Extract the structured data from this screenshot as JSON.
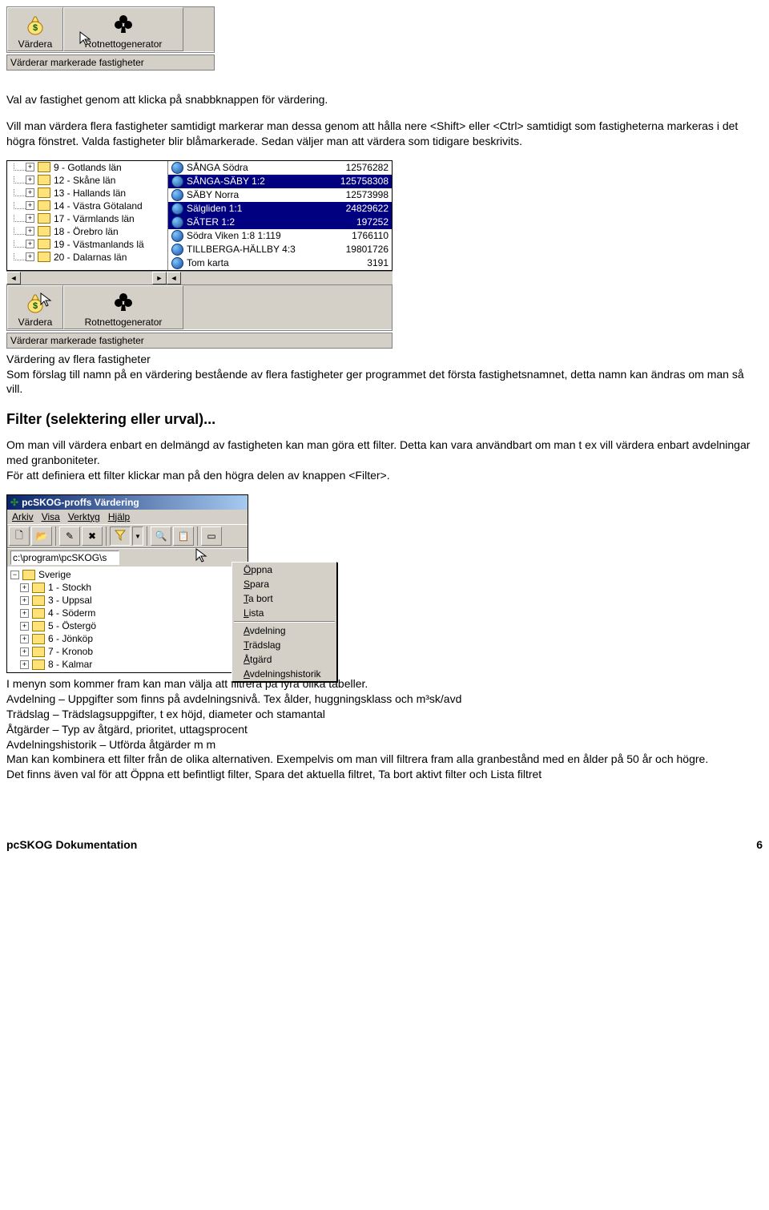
{
  "screenshot1": {
    "buttons": {
      "vardera": "Värdera",
      "rotnetto": "Rotnettogenerator"
    },
    "status": "Värderar markerade fastigheter"
  },
  "para1": "Val av fastighet genom att klicka på snabbknappen för värdering.",
  "para2": "Vill man värdera flera fastigheter samtidigt markerar man dessa genom att hålla nere <Shift> eller <Ctrl> samtidigt som fastigheterna markeras i det högra fönstret. Valda fastigheter blir blåmarkerade. Sedan väljer man att värdera som tidigare beskrivits.",
  "screenshot2": {
    "tree": [
      "9 - Gotlands län",
      "12 - Skåne län",
      "13 - Hallands län",
      "14 - Västra Götaland",
      "17 - Värmlands län",
      "18 - Örebro län",
      "19 - Västmanlands lä",
      "20 - Dalarnas län"
    ],
    "list": [
      {
        "name": "SÅNGA Södra",
        "value": "12576282",
        "selected": false
      },
      {
        "name": "SÅNGA-SÄBY 1:2",
        "value": "125758308",
        "selected": true
      },
      {
        "name": "SÄBY Norra",
        "value": "12573998",
        "selected": false
      },
      {
        "name": "Sälgliden 1:1",
        "value": "24829622",
        "selected": true
      },
      {
        "name": "SÄTER 1:2",
        "value": "197252",
        "selected": true
      },
      {
        "name": "Södra Viken 1:8 1:119",
        "value": "1766110",
        "selected": false
      },
      {
        "name": "TILLBERGA-HÄLLBY 4:3",
        "value": "19801726",
        "selected": false
      },
      {
        "name": "Tom karta",
        "value": "3191",
        "selected": false
      }
    ],
    "buttons": {
      "vardera": "Värdera",
      "rotnetto": "Rotnettogenerator"
    },
    "status": "Värderar markerade fastigheter"
  },
  "para3": "Värdering av flera fastigheter\nSom förslag till namn på en värdering bestående av flera fastigheter ger programmet det första fastighetsnamnet, detta namn kan ändras om man så vill.",
  "heading_filter": "Filter (selektering eller urval)...",
  "para4": "Om man vill värdera enbart en delmängd av fastigheten kan man göra ett filter. Detta kan vara användbart om man t ex vill värdera enbart avdelningar med granboniteter.\nFör att definiera ett filter klickar man på  den högra delen av knappen <Filter>.",
  "screenshot3": {
    "title": "pcSKOG-proffs Värdering",
    "menu": [
      "Arkiv",
      "Visa",
      "Verktyg",
      "Hjälp"
    ],
    "path": "c:\\program\\pcSKOG\\s",
    "root": "Sverige",
    "tree": [
      "1 - Stockh",
      "3 - Uppsal",
      "4 - Söderm",
      "5 - Östergö",
      "6 - Jönköp",
      "7 - Kronob",
      "8 - Kalmar"
    ],
    "popup": [
      "Öppna",
      "Spara",
      "Ta bort",
      "Lista",
      "—",
      "Avdelning",
      "Trädslag",
      "Åtgärd",
      "Avdelningshistorik"
    ]
  },
  "para5": "I menyn som kommer fram kan man välja att filtrera på fyra olika tabeller.\nAvdelning – Uppgifter som finns på avdelningsnivå. Tex ålder, huggningsklass och m³sk/avd\nTrädslag – Trädslagsuppgifter, t ex höjd, diameter och stamantal\nÅtgärder – Typ av åtgärd, prioritet, uttagsprocent\nAvdelningshistorik – Utförda åtgärder m m\nMan kan kombinera ett filter från de olika alternativen. Exempelvis om man vill filtrera fram alla granbestånd med en ålder på 50 år och högre.\nDet finns även val för att Öppna ett befintligt filter, Spara det aktuella filtret, Ta bort aktivt filter och Lista filtret",
  "footer": {
    "left": "pcSKOG Dokumentation",
    "right": "6"
  }
}
